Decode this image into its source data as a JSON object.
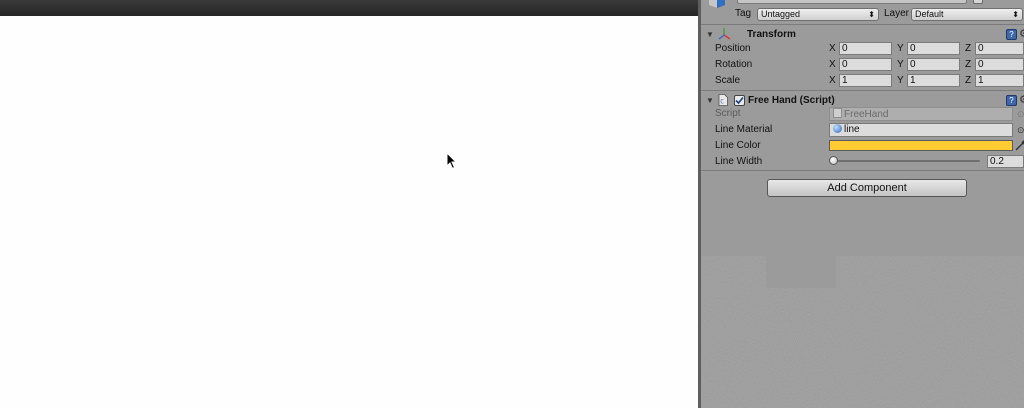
{
  "inspector": {
    "tag": {
      "label": "Tag",
      "value": "Untagged"
    },
    "layer": {
      "label": "Layer",
      "value": "Default"
    },
    "transform": {
      "title": "Transform",
      "rows": [
        {
          "label": "Position",
          "x": "0",
          "y": "0",
          "z": "0"
        },
        {
          "label": "Rotation",
          "x": "0",
          "y": "0",
          "z": "0"
        },
        {
          "label": "Scale",
          "x": "1",
          "y": "1",
          "z": "1"
        }
      ],
      "axes": {
        "x": "X",
        "y": "Y",
        "z": "Z"
      }
    },
    "script_component": {
      "title": "Free Hand (Script)",
      "enabled": true,
      "fields": {
        "script": {
          "label": "Script",
          "value": "FreeHand"
        },
        "line_material": {
          "label": "Line Material",
          "value": "line"
        },
        "line_color": {
          "label": "Line Color",
          "color": "#FFCC33"
        },
        "line_width": {
          "label": "Line Width",
          "value": "0.2",
          "fraction": 0.0
        }
      }
    },
    "add_component_label": "Add Component"
  },
  "colors": {
    "inspector_bg": "#9B9B9B",
    "game_view_bg": "#FEFEFE",
    "toolbar_bg": "#2E2E2E",
    "help_icon": "#3F66A8"
  },
  "icons": {
    "object": "cube-icon",
    "transform": "transform-axes-icon",
    "script": "script-file-icon",
    "help": "help-book-icon",
    "settings": "gear-icon",
    "material": "material-sphere-icon",
    "color_picker": "eyedropper-icon",
    "object_picker": "target-circle-icon",
    "cursor": "mouse-pointer-icon"
  }
}
